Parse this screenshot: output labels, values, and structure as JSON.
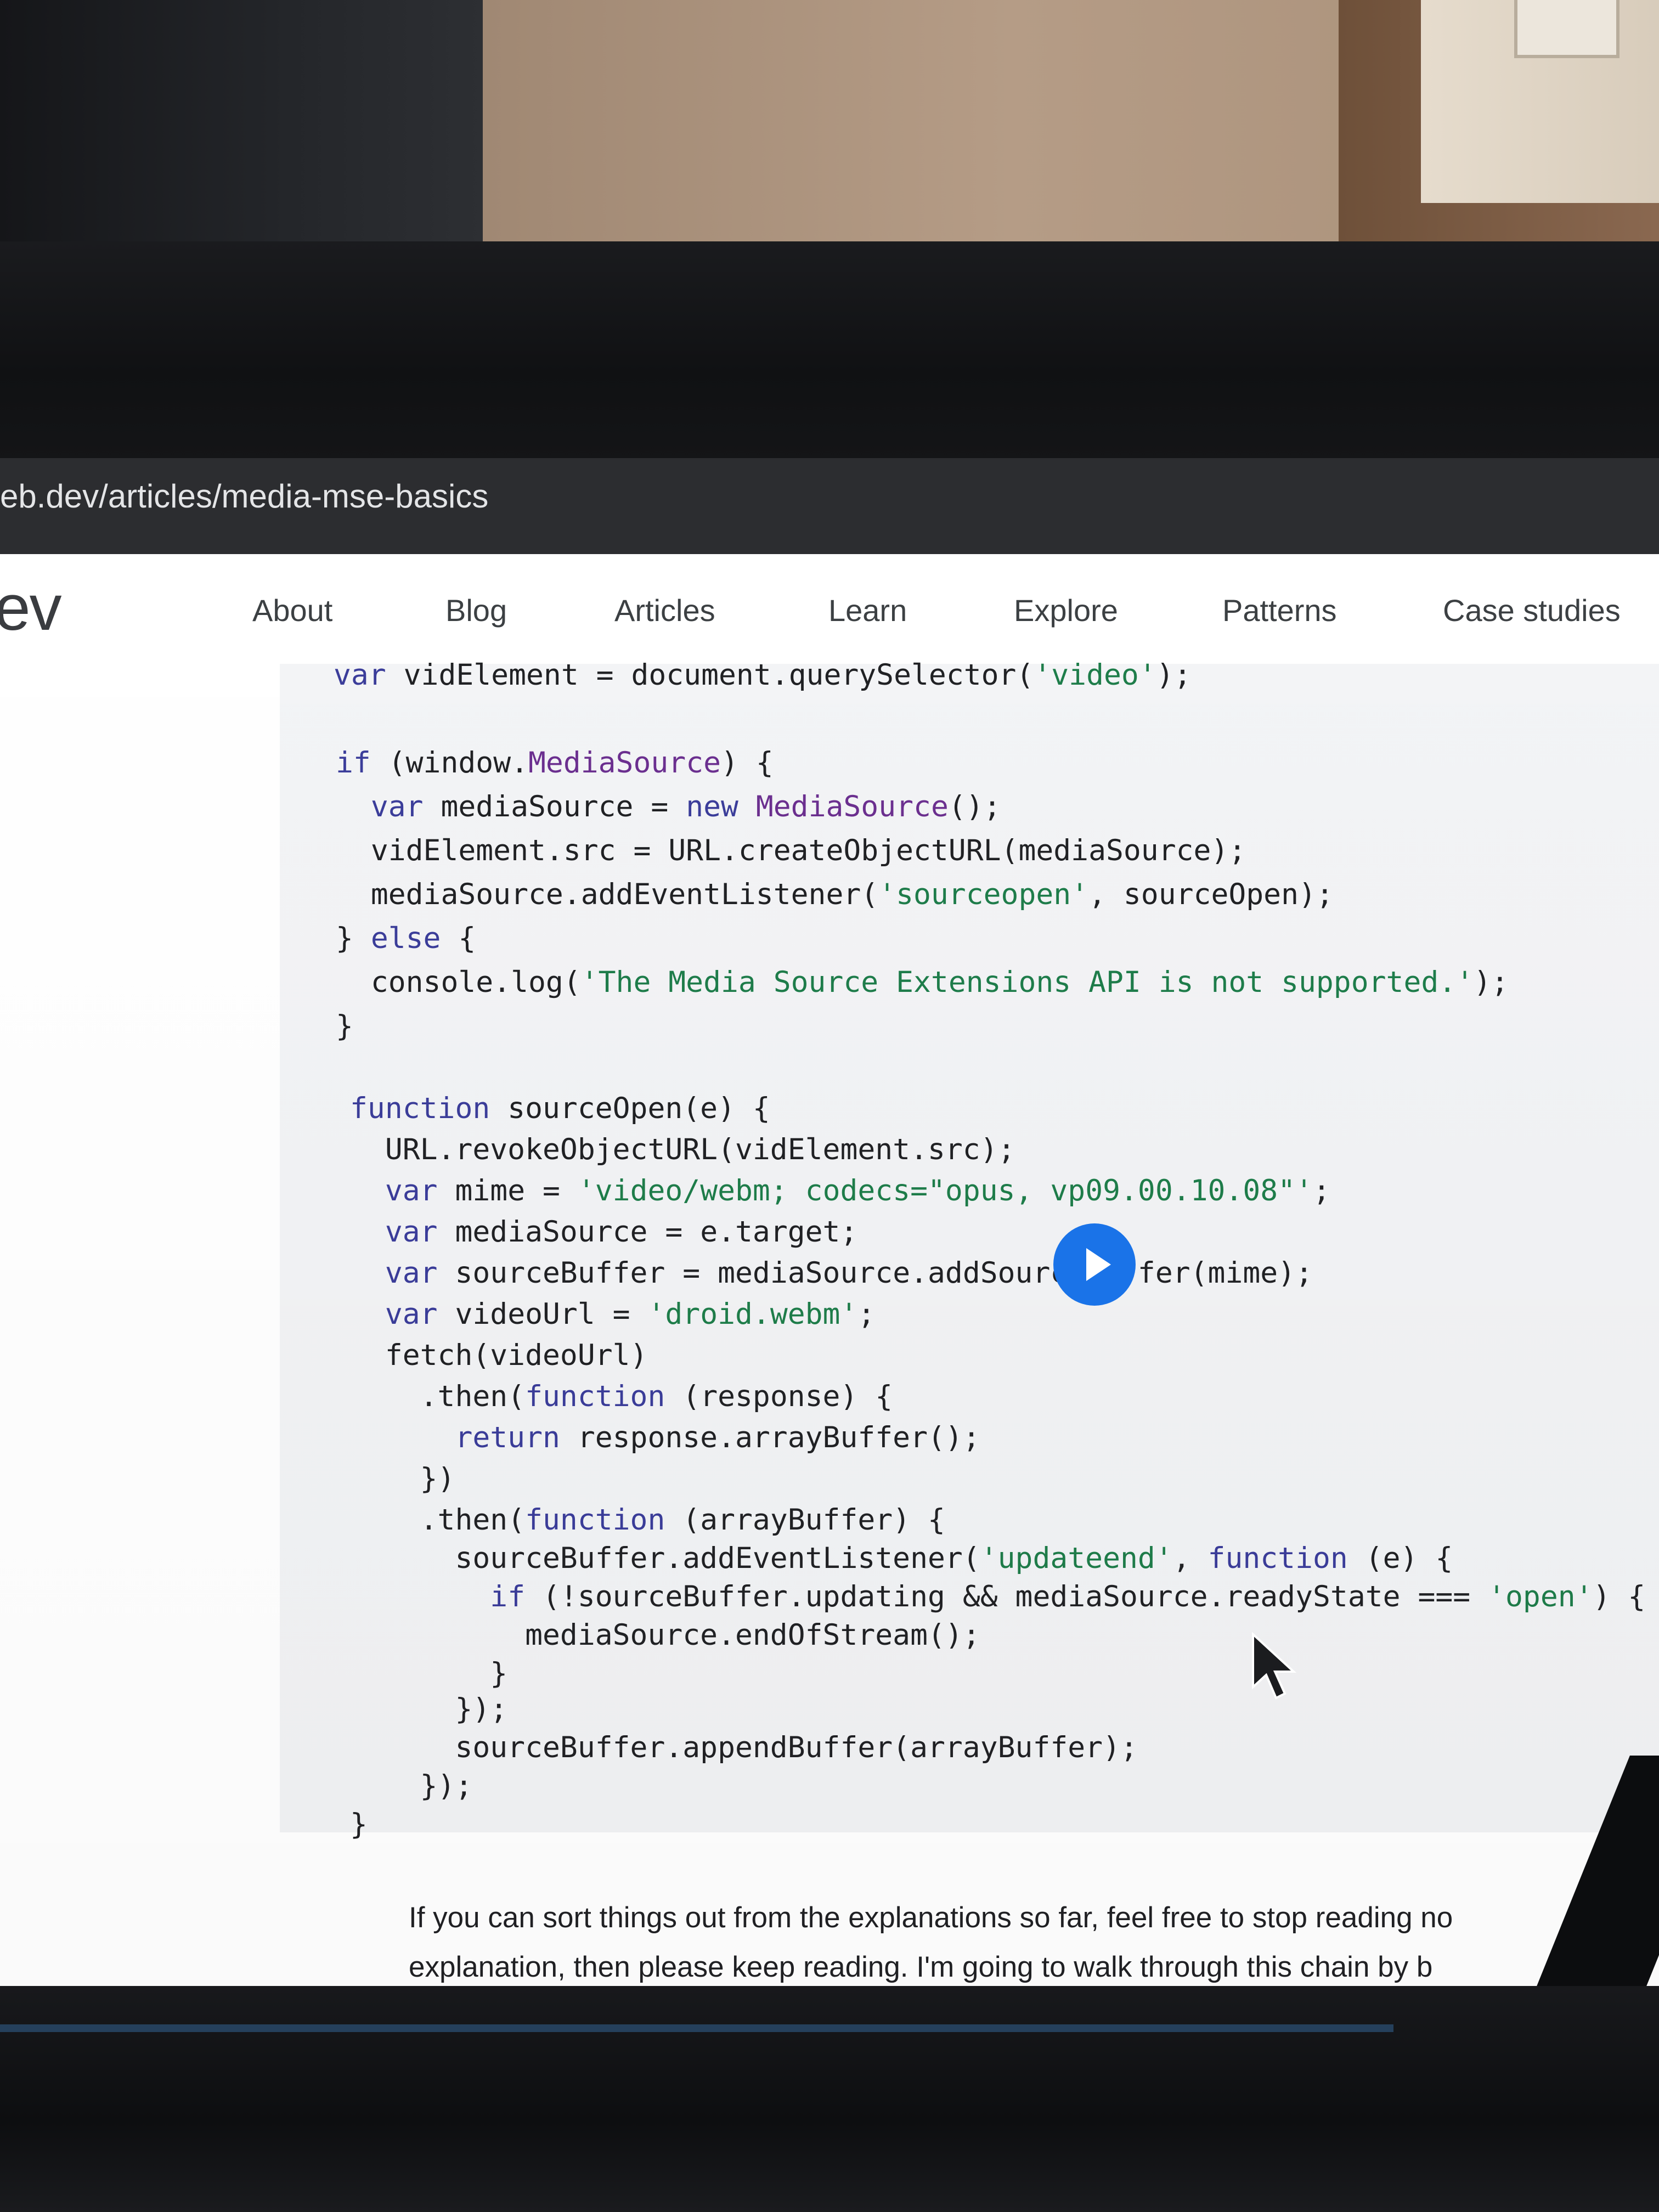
{
  "browser": {
    "url": "eb.dev/articles/media-mse-basics"
  },
  "site": {
    "logo_text": "ev",
    "nav": [
      "About",
      "Blog",
      "Articles",
      "Learn",
      "Explore",
      "Patterns",
      "Case studies"
    ]
  },
  "code_lines": [
    "var vidElement = document.querySelector('video');",
    "",
    "if (window.MediaSource) {",
    "  var mediaSource = new MediaSource();",
    "  vidElement.src = URL.createObjectURL(mediaSource);",
    "  mediaSource.addEventListener('sourceopen', sourceOpen);",
    "} else {",
    "  console.log('The Media Source Extensions API is not supported.');",
    "}",
    "",
    "function sourceOpen(e) {",
    "  URL.revokeObjectURL(vidElement.src);",
    "  var mime = 'video/webm; codecs=\"opus, vp09.00.10.08\"';",
    "  var mediaSource = e.target;",
    "  var sourceBuffer = mediaSource.addSourceBuffer(mime);",
    "  var videoUrl = 'droid.webm';",
    "  fetch(videoUrl)",
    "    .then(function (response) {",
    "      return response.arrayBuffer();",
    "    })",
    "    .then(function (arrayBuffer) {",
    "      sourceBuffer.addEventListener('updateend', function (e) {",
    "        if (!sourceBuffer.updating && mediaSource.readyState === 'open') {",
    "          mediaSource.endOfStream();",
    "        }",
    "      });",
    "      sourceBuffer.appendBuffer(arrayBuffer);",
    "    });",
    "}"
  ],
  "prose_lines": [
    "If you can sort things out from the explanations so far, feel free to stop reading no",
    "explanation, then please keep reading. I'm going to walk through this chain by b"
  ],
  "colors": {
    "play_button": "#1a73e8",
    "code_background": "#f2f3f5"
  },
  "icons": {
    "play": "play-icon",
    "cursor": "mouse-pointer-icon"
  }
}
